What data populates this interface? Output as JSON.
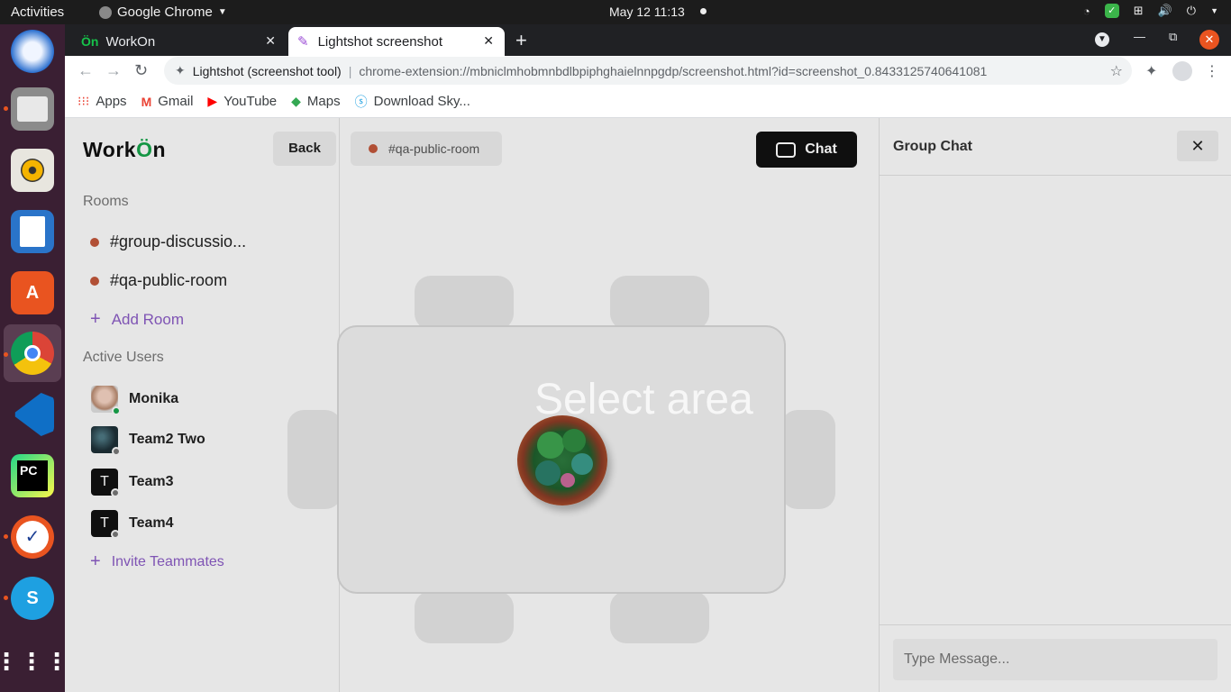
{
  "topbar": {
    "activities": "Activities",
    "app_name": "Google Chrome",
    "clock": "May 12  11:13"
  },
  "browser": {
    "tabs": [
      {
        "label": "WorkOn",
        "favicon": "workon-icon"
      },
      {
        "label": "Lightshot screenshot",
        "favicon": "feather-icon"
      }
    ],
    "site_name": "Lightshot (screenshot tool)",
    "url": "chrome-extension://mbniclmhobmnbdlbpiphghaielnnpgdp/screenshot.html?id=screenshot_0.8433125740641081",
    "bookmarks": [
      {
        "label": "Apps",
        "icon": "apps-grid-icon"
      },
      {
        "label": "Gmail",
        "icon": "gmail-icon"
      },
      {
        "label": "YouTube",
        "icon": "youtube-icon"
      },
      {
        "label": "Maps",
        "icon": "maps-icon"
      },
      {
        "label": "Download Sky...",
        "icon": "skype-icon"
      }
    ]
  },
  "app": {
    "logo_left": "Work",
    "logo_o": "Ö",
    "logo_right": "n",
    "back_label": "Back",
    "current_room": "#qa-public-room",
    "chat_label": "Chat",
    "rooms_label": "Rooms",
    "rooms": [
      "#group-discussio...",
      "#qa-public-room"
    ],
    "add_room_label": "Add Room",
    "active_users_label": "Active Users",
    "users": [
      {
        "name": "Monika",
        "status": "online",
        "avatar": "photo"
      },
      {
        "name": "Team2 Two",
        "status": "offline",
        "avatar": "photo"
      },
      {
        "name": "Team3",
        "status": "offline",
        "avatar": "T"
      },
      {
        "name": "Team4",
        "status": "offline",
        "avatar": "T"
      }
    ],
    "invite_label": "Invite Teammates",
    "overlay_text": "Select area"
  },
  "chat_panel": {
    "title": "Group Chat",
    "message_placeholder": "Type Message..."
  },
  "colors": {
    "accent": "#8a5cc4",
    "room_bullet": "#c0563a",
    "online": "#16a34a",
    "dock_bg": "#3a1f33",
    "ubuntu_orange": "#e95420"
  }
}
